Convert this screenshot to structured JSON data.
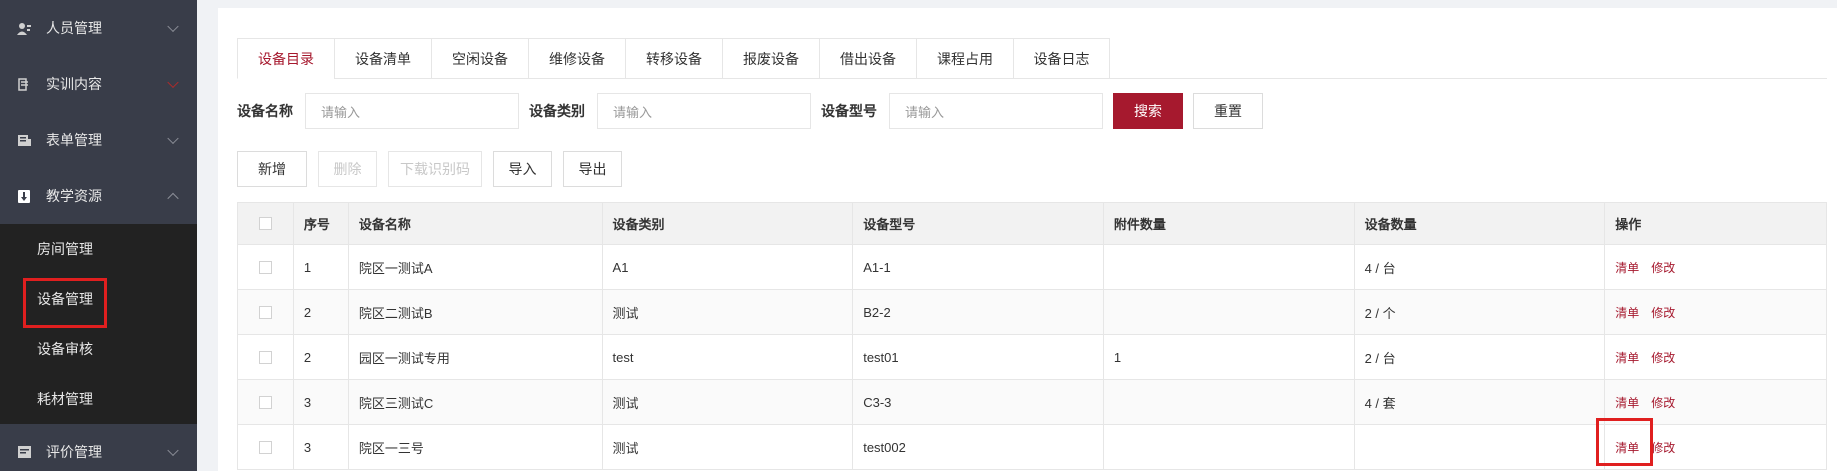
{
  "sidebar": {
    "groups_top": [
      {
        "label": "人员管理",
        "icon": "user-icon"
      },
      {
        "label": "实训内容",
        "icon": "book-icon"
      },
      {
        "label": "表单管理",
        "icon": "form-icon"
      },
      {
        "label": "教学资源",
        "icon": "resource-icon"
      }
    ],
    "sub_items": [
      {
        "label": "房间管理"
      },
      {
        "label": "设备管理"
      },
      {
        "label": "设备审核"
      },
      {
        "label": "耗材管理"
      }
    ],
    "group_bottom": {
      "label": "评价管理",
      "icon": "evaluate-icon"
    }
  },
  "tabs": [
    "设备目录",
    "设备清单",
    "空闲设备",
    "维修设备",
    "转移设备",
    "报废设备",
    "借出设备",
    "课程占用",
    "设备日志"
  ],
  "search": {
    "name_label": "设备名称",
    "name_placeholder": "请输入",
    "type_label": "设备类别",
    "type_placeholder": "请输入",
    "model_label": "设备型号",
    "model_placeholder": "请输入",
    "search_button": "搜索",
    "reset_button": "重置"
  },
  "actions": {
    "add": "新增",
    "delete": "删除",
    "download_code": "下载识别码",
    "import": "导入",
    "export": "导出"
  },
  "table": {
    "headers": [
      "序号",
      "设备名称",
      "设备类别",
      "设备型号",
      "附件数量",
      "设备数量",
      "操作"
    ],
    "rows": [
      {
        "no": "1",
        "name": "院区一测试A",
        "type": "A1",
        "model": "A1-1",
        "attach": "",
        "qty": "4 / 台",
        "op1": "清单",
        "op2": "修改"
      },
      {
        "no": "2",
        "name": "院区二测试B",
        "type": "测试",
        "model": "B2-2",
        "attach": "",
        "qty": "2 / 个",
        "op1": "清单",
        "op2": "修改"
      },
      {
        "no": "2",
        "name": "园区一测试专用",
        "type": "test",
        "model": "test01",
        "attach": "1",
        "qty": "2 / 台",
        "op1": "清单",
        "op2": "修改"
      },
      {
        "no": "3",
        "name": "院区三测试C",
        "type": "测试",
        "model": "C3-3",
        "attach": "",
        "qty": "4 / 套",
        "op1": "清单",
        "op2": "修改"
      },
      {
        "no": "3",
        "name": "院区一三号",
        "type": "测试",
        "model": "test002",
        "attach": "",
        "qty": "",
        "op1": "清单",
        "op2": "修改"
      }
    ]
  },
  "colors": {
    "accent": "#a6192e",
    "sidebar_bg": "#393d49",
    "highlight": "#e01f1f"
  }
}
